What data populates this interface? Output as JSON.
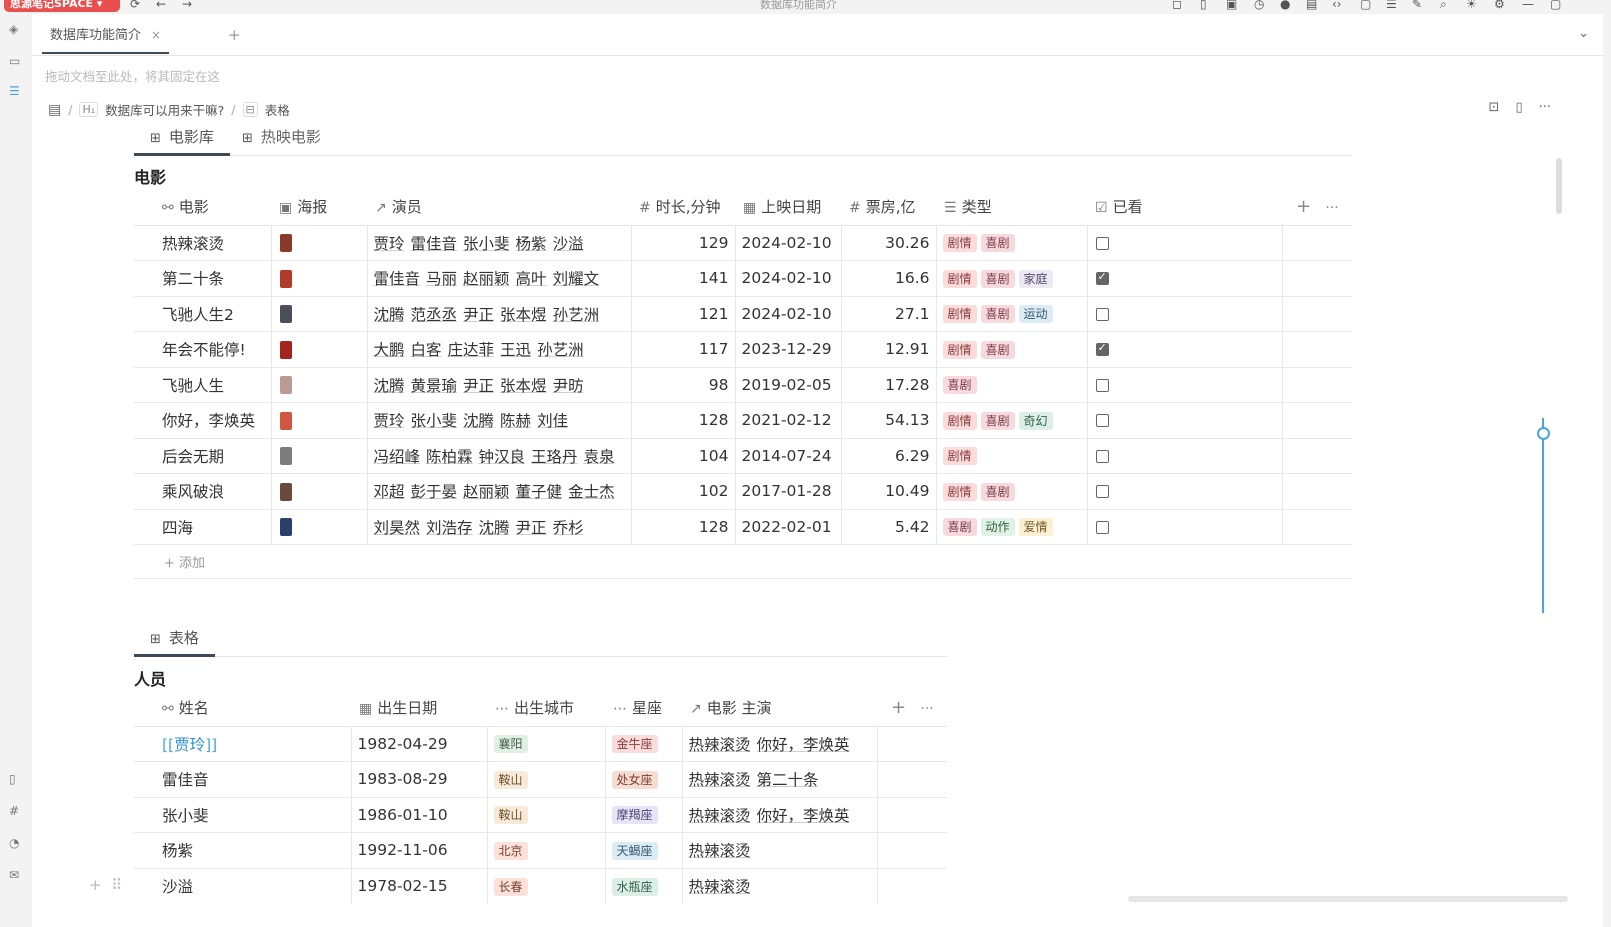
{
  "window": {
    "workspace_badge": "思源笔记SPACE ▾",
    "title": "数据库功能简介"
  },
  "tabs": [
    {
      "label": "数据库功能简介",
      "close": "×"
    }
  ],
  "tab_add": "+",
  "pin_hint": "拖动文档至此处，将其固定在这",
  "breadcrumb": {
    "heading_badge": "H₁",
    "heading": "数据库可以用来干嘛?",
    "sep": "/",
    "block_badge": "⊟",
    "block": "表格"
  },
  "db1": {
    "views": [
      {
        "label": "电影库",
        "active": true
      },
      {
        "label": "热映电影",
        "active": false
      }
    ],
    "title": "电影",
    "columns": [
      {
        "icon": "⚯",
        "label": "电影"
      },
      {
        "icon": "▣",
        "label": "海报"
      },
      {
        "icon": "↗",
        "label": "演员"
      },
      {
        "icon": "#",
        "label": "时长,分钟"
      },
      {
        "icon": "▦",
        "label": "上映日期"
      },
      {
        "icon": "#",
        "label": "票房,亿"
      },
      {
        "icon": "☰",
        "label": "类型"
      },
      {
        "icon": "☑",
        "label": "已看"
      }
    ],
    "add_column": "+",
    "more": "···",
    "rows": [
      {
        "name": "热辣滚烫",
        "poster_color": "#8b3a2a",
        "actors": [
          "贾玲",
          "雷佳音",
          "张小斐",
          "杨紫",
          "沙溢"
        ],
        "duration": "129",
        "date": "2024-02-10",
        "box": "30.26",
        "tags": [
          [
            "剧情",
            "t-juqing"
          ],
          [
            "喜剧",
            "t-xiju"
          ]
        ],
        "seen": false
      },
      {
        "name": "第二十条",
        "poster_color": "#b23a2b",
        "actors": [
          "雷佳音",
          "马丽",
          "赵丽颖",
          "高叶",
          "刘耀文"
        ],
        "duration": "141",
        "date": "2024-02-10",
        "box": "16.6",
        "tags": [
          [
            "剧情",
            "t-juqing"
          ],
          [
            "喜剧",
            "t-xiju"
          ],
          [
            "家庭",
            "t-jiating"
          ]
        ],
        "seen": true
      },
      {
        "name": "飞驰人生2",
        "poster_color": "#4a4f5a",
        "actors": [
          "沈腾",
          "范丞丞",
          "尹正",
          "张本煜",
          "孙艺洲"
        ],
        "duration": "121",
        "date": "2024-02-10",
        "box": "27.1",
        "tags": [
          [
            "剧情",
            "t-juqing"
          ],
          [
            "喜剧",
            "t-xiju"
          ],
          [
            "运动",
            "t-yundong"
          ]
        ],
        "seen": false
      },
      {
        "name": "年会不能停!",
        "poster_color": "#a3231d",
        "actors": [
          "大鹏",
          "白客",
          "庄达菲",
          "王迅",
          "孙艺洲"
        ],
        "duration": "117",
        "date": "2023-12-29",
        "box": "12.91",
        "tags": [
          [
            "剧情",
            "t-juqing"
          ],
          [
            "喜剧",
            "t-xiju"
          ]
        ],
        "seen": true
      },
      {
        "name": "飞驰人生",
        "poster_color": "#b99b93",
        "actors": [
          "沈腾",
          "黄景瑜",
          "尹正",
          "张本煜",
          "尹昉"
        ],
        "duration": "98",
        "date": "2019-02-05",
        "box": "17.28",
        "tags": [
          [
            "喜剧",
            "t-xiju"
          ]
        ],
        "seen": false
      },
      {
        "name": "你好，李焕英",
        "poster_color": "#d2553f",
        "actors": [
          "贾玲",
          "张小斐",
          "沈腾",
          "陈赫",
          "刘佳"
        ],
        "duration": "128",
        "date": "2021-02-12",
        "box": "54.13",
        "tags": [
          [
            "剧情",
            "t-juqing"
          ],
          [
            "喜剧",
            "t-xiju"
          ],
          [
            "奇幻",
            "t-qihuan"
          ]
        ],
        "seen": false
      },
      {
        "name": "后会无期",
        "poster_color": "#7d7d7d",
        "actors": [
          "冯绍峰",
          "陈柏霖",
          "钟汉良",
          "王珞丹",
          "袁泉"
        ],
        "duration": "104",
        "date": "2014-07-24",
        "box": "6.29",
        "tags": [
          [
            "剧情",
            "t-juqing"
          ]
        ],
        "seen": false
      },
      {
        "name": "乘风破浪",
        "poster_color": "#6a4a3c",
        "actors": [
          "邓超",
          "彭于晏",
          "赵丽颖",
          "董子健",
          "金士杰"
        ],
        "duration": "102",
        "date": "2017-01-28",
        "box": "10.49",
        "tags": [
          [
            "剧情",
            "t-juqing"
          ],
          [
            "喜剧",
            "t-xiju"
          ]
        ],
        "seen": false
      },
      {
        "name": "四海",
        "poster_color": "#2b3f6b",
        "actors": [
          "刘昊然",
          "刘浩存",
          "沈腾",
          "尹正",
          "乔杉"
        ],
        "duration": "128",
        "date": "2022-02-01",
        "box": "5.42",
        "tags": [
          [
            "喜剧",
            "t-xiju"
          ],
          [
            "动作",
            "t-dongzuo"
          ],
          [
            "爱情",
            "t-aiqing"
          ]
        ],
        "seen": false
      }
    ],
    "add_row": "+ 添加"
  },
  "db2": {
    "views": [
      {
        "label": "表格",
        "active": true
      }
    ],
    "title": "人员",
    "columns": [
      {
        "icon": "⚯",
        "label": "姓名"
      },
      {
        "icon": "▦",
        "label": "出生日期"
      },
      {
        "icon": "⋯",
        "label": "出生城市"
      },
      {
        "icon": "⋯",
        "label": "星座"
      },
      {
        "icon": "↗",
        "label": "电影 主演"
      }
    ],
    "add_column": "+",
    "more": "···",
    "rows": [
      {
        "name": "贾玲",
        "is_link": true,
        "date": "1982-04-29",
        "city": [
          "襄阳",
          "city2"
        ],
        "star": [
          "金牛座",
          "star1"
        ],
        "movies": [
          "热辣滚烫",
          "你好，李焕英"
        ]
      },
      {
        "name": "雷佳音",
        "is_link": false,
        "date": "1983-08-29",
        "city": [
          "鞍山",
          "city"
        ],
        "star": [
          "处女座",
          "star2"
        ],
        "movies": [
          "热辣滚烫",
          "第二十条"
        ]
      },
      {
        "name": "张小斐",
        "is_link": false,
        "date": "1986-01-10",
        "city": [
          "鞍山",
          "city"
        ],
        "star": [
          "摩羯座",
          "star3"
        ],
        "movies": [
          "热辣滚烫",
          "你好，李焕英"
        ]
      },
      {
        "name": "杨紫",
        "is_link": false,
        "date": "1992-11-06",
        "city": [
          "北京",
          "city3"
        ],
        "star": [
          "天蝎座",
          "star4"
        ],
        "movies": [
          "热辣滚烫"
        ]
      },
      {
        "name": "沙溢",
        "is_link": false,
        "date": "1978-02-15",
        "city": [
          "长春",
          "city3"
        ],
        "star": [
          "水瓶座",
          "star5"
        ],
        "movies": [
          "热辣滚烫"
        ]
      }
    ]
  }
}
